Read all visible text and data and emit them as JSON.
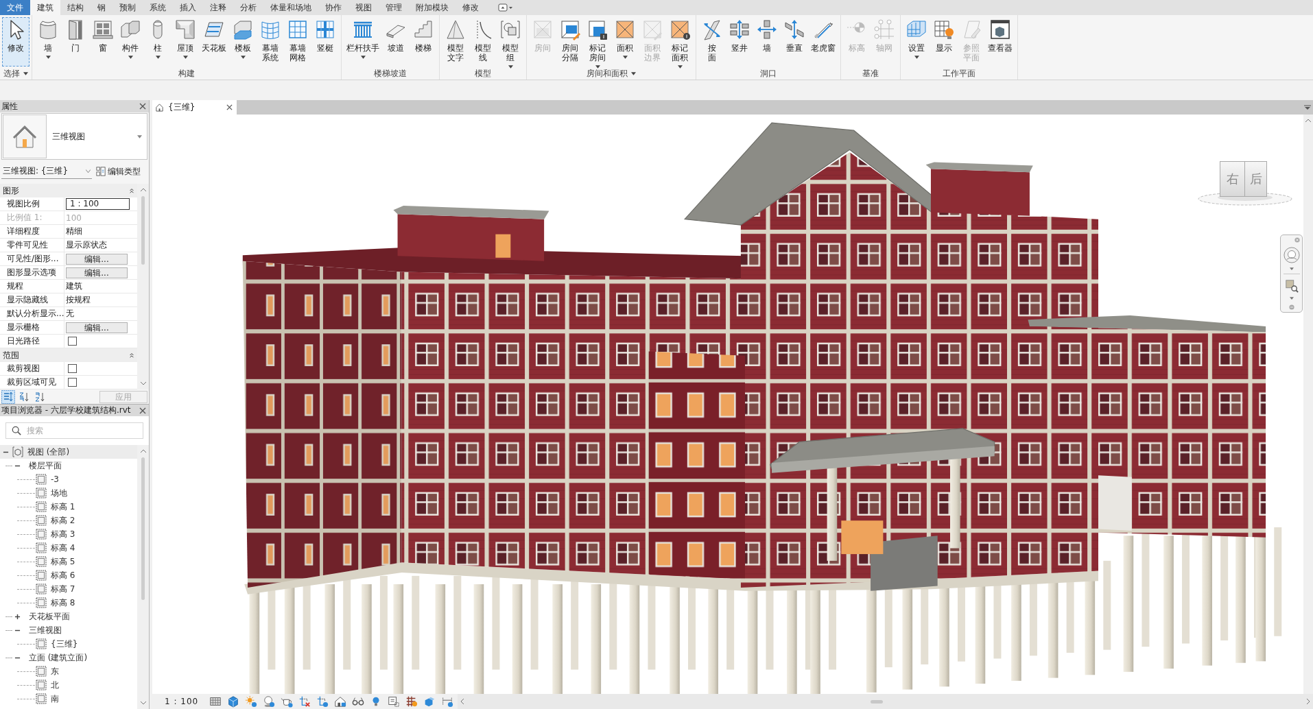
{
  "ribbon": {
    "tabs": [
      {
        "label": "文件",
        "kind": "file",
        "selected": false
      },
      {
        "label": "建筑",
        "kind": "tab",
        "selected": true
      },
      {
        "label": "结构",
        "kind": "tab",
        "selected": false
      },
      {
        "label": "钢",
        "kind": "tab",
        "selected": false
      },
      {
        "label": "预制",
        "kind": "tab",
        "selected": false
      },
      {
        "label": "系统",
        "kind": "tab",
        "selected": false
      },
      {
        "label": "插入",
        "kind": "tab",
        "selected": false
      },
      {
        "label": "注释",
        "kind": "tab",
        "selected": false
      },
      {
        "label": "分析",
        "kind": "tab",
        "selected": false
      },
      {
        "label": "体量和场地",
        "kind": "tab",
        "selected": false
      },
      {
        "label": "协作",
        "kind": "tab",
        "selected": false
      },
      {
        "label": "视图",
        "kind": "tab",
        "selected": false
      },
      {
        "label": "管理",
        "kind": "tab",
        "selected": false
      },
      {
        "label": "附加模块",
        "kind": "tab",
        "selected": false
      },
      {
        "label": "修改",
        "kind": "tab",
        "selected": false
      }
    ],
    "panels": [
      {
        "title": "选择",
        "menu": true,
        "tools": [
          {
            "label": "修改",
            "kind": "cursor",
            "selected": true,
            "disabled": false,
            "menu": false
          }
        ]
      },
      {
        "title": "构建",
        "menu": false,
        "tools": [
          {
            "label": "墙",
            "kind": "wall",
            "selected": false,
            "disabled": false,
            "menu": true
          },
          {
            "label": "门",
            "kind": "door",
            "selected": false,
            "disabled": false,
            "menu": false
          },
          {
            "label": "窗",
            "kind": "window",
            "selected": false,
            "disabled": false,
            "menu": false
          },
          {
            "label": "构件",
            "kind": "component",
            "selected": false,
            "disabled": false,
            "menu": true
          },
          {
            "label": "柱",
            "kind": "column",
            "selected": false,
            "disabled": false,
            "menu": true
          },
          {
            "label": "屋顶",
            "kind": "roof",
            "selected": false,
            "disabled": false,
            "menu": true
          },
          {
            "label": "天花板",
            "kind": "ceiling",
            "selected": false,
            "disabled": false,
            "menu": false
          },
          {
            "label": "楼板",
            "kind": "slab",
            "selected": false,
            "disabled": false,
            "menu": true
          },
          {
            "label": "幕墙系统",
            "kind": "curtainwall",
            "selected": false,
            "disabled": false,
            "menu": false
          },
          {
            "label": "幕墙网格",
            "kind": "curtaingrid",
            "selected": false,
            "disabled": false,
            "menu": false
          },
          {
            "label": "竖梃",
            "kind": "mullion",
            "selected": false,
            "disabled": false,
            "menu": false
          }
        ]
      },
      {
        "title": "楼梯坡道",
        "menu": false,
        "tools": [
          {
            "label": "栏杆扶手",
            "kind": "railing",
            "selected": false,
            "disabled": false,
            "menu": true
          },
          {
            "label": "坡道",
            "kind": "ramp",
            "selected": false,
            "disabled": false,
            "menu": false
          },
          {
            "label": "楼梯",
            "kind": "stair",
            "selected": false,
            "disabled": false,
            "menu": false
          }
        ]
      },
      {
        "title": "模型",
        "menu": false,
        "tools": [
          {
            "label": "模型文字",
            "kind": "modeltext",
            "selected": false,
            "disabled": false,
            "menu": false
          },
          {
            "label": "模型线",
            "kind": "modelline",
            "selected": false,
            "disabled": false,
            "menu": false
          },
          {
            "label": "模型组",
            "kind": "modelgroup",
            "selected": false,
            "disabled": false,
            "menu": true
          }
        ]
      },
      {
        "title": "房间和面积",
        "menu": true,
        "tools": [
          {
            "label": "房间",
            "kind": "room",
            "selected": false,
            "disabled": true,
            "menu": false
          },
          {
            "label": "房间分隔",
            "kind": "separator",
            "selected": false,
            "disabled": false,
            "menu": false
          },
          {
            "label": "标记房间",
            "kind": "roomtag",
            "selected": false,
            "disabled": false,
            "menu": true
          },
          {
            "label": "面积",
            "kind": "area",
            "selected": false,
            "disabled": false,
            "menu": true
          },
          {
            "label": "面积边界",
            "kind": "boundary",
            "selected": false,
            "disabled": true,
            "menu": false
          },
          {
            "label": "标记面积",
            "kind": "areatag",
            "selected": false,
            "disabled": false,
            "menu": true
          }
        ]
      },
      {
        "title": "洞口",
        "menu": false,
        "tools": [
          {
            "label": "按面",
            "kind": "byface",
            "selected": false,
            "disabled": false,
            "menu": false
          },
          {
            "label": "竖井",
            "kind": "shaft",
            "selected": false,
            "disabled": false,
            "menu": false
          },
          {
            "label": "墙",
            "kind": "wallopening",
            "selected": false,
            "disabled": false,
            "menu": false
          },
          {
            "label": "垂直",
            "kind": "vertical",
            "selected": false,
            "disabled": false,
            "menu": false
          },
          {
            "label": "老虎窗",
            "kind": "dormer",
            "selected": false,
            "disabled": false,
            "menu": false
          }
        ]
      },
      {
        "title": "基准",
        "menu": false,
        "tools": [
          {
            "label": "标高",
            "kind": "level",
            "selected": false,
            "disabled": true,
            "menu": false
          },
          {
            "label": "轴网",
            "kind": "grid",
            "selected": false,
            "disabled": true,
            "menu": false
          }
        ]
      },
      {
        "title": "工作平面",
        "menu": false,
        "tools": [
          {
            "label": "设置",
            "kind": "setplane",
            "selected": false,
            "disabled": false,
            "menu": true
          },
          {
            "label": "显示",
            "kind": "showplane",
            "selected": false,
            "disabled": false,
            "menu": false
          },
          {
            "label": "参照平面",
            "kind": "refplane",
            "selected": false,
            "disabled": true,
            "menu": false
          },
          {
            "label": "查看器",
            "kind": "viewer",
            "selected": false,
            "disabled": false,
            "menu": false
          }
        ]
      }
    ]
  },
  "properties": {
    "title": "属性",
    "type_selector": {
      "name": "三维视图"
    },
    "instance": {
      "label": "三维视图: {三维}",
      "edit_type": "编辑类型"
    },
    "groups": [
      {
        "title": "图形",
        "expanded": true,
        "rows": [
          {
            "label": "视图比例",
            "kind": "input",
            "value": "1 : 100",
            "disabled": false
          },
          {
            "label": "比例值 1:",
            "kind": "text",
            "value": "100",
            "disabled": true
          },
          {
            "label": "详细程度",
            "kind": "text",
            "value": "精细",
            "disabled": false
          },
          {
            "label": "零件可见性",
            "kind": "text",
            "value": "显示原状态",
            "disabled": false
          },
          {
            "label": "可见性/图形...",
            "kind": "button",
            "value": "编辑...",
            "disabled": false
          },
          {
            "label": "图形显示选项",
            "kind": "button",
            "value": "编辑...",
            "disabled": false
          },
          {
            "label": "规程",
            "kind": "text",
            "value": "建筑",
            "disabled": false
          },
          {
            "label": "显示隐藏线",
            "kind": "text",
            "value": "按规程",
            "disabled": false
          },
          {
            "label": "默认分析显示...",
            "kind": "text",
            "value": "无",
            "disabled": false
          },
          {
            "label": "显示栅格",
            "kind": "button",
            "value": "编辑...",
            "disabled": false
          },
          {
            "label": "日光路径",
            "kind": "checkbox",
            "checked": false,
            "disabled": false
          }
        ]
      },
      {
        "title": "范围",
        "expanded": true,
        "rows": [
          {
            "label": "裁剪视图",
            "kind": "checkbox",
            "checked": false,
            "disabled": false
          },
          {
            "label": "裁剪区域可见",
            "kind": "checkbox",
            "checked": false,
            "disabled": false
          }
        ]
      }
    ],
    "sort_buttons": [
      {
        "kind": "category",
        "selected": true
      },
      {
        "kind": "ascending",
        "selected": false
      },
      {
        "kind": "descending",
        "selected": false
      }
    ],
    "apply": {
      "label": "应用",
      "disabled": true
    }
  },
  "project_browser": {
    "title": "项目浏览器 - 六层学校建筑结构.rvt",
    "search": {
      "placeholder": "搜索"
    },
    "tree": [
      {
        "label": "视图 (全部)",
        "kind": "root",
        "selected": true,
        "expanded": true,
        "children": [
          {
            "label": "楼层平面",
            "kind": "group",
            "selected": false,
            "expanded": true,
            "children": [
              {
                "label": "-3",
                "kind": "view",
                "selected": false
              },
              {
                "label": "场地",
                "kind": "view",
                "selected": false
              },
              {
                "label": "标高 1",
                "kind": "view",
                "selected": false
              },
              {
                "label": "标高 2",
                "kind": "view",
                "selected": false
              },
              {
                "label": "标高 3",
                "kind": "view",
                "selected": false
              },
              {
                "label": "标高 4",
                "kind": "view",
                "selected": false
              },
              {
                "label": "标高 5",
                "kind": "view",
                "selected": false
              },
              {
                "label": "标高 6",
                "kind": "view",
                "selected": false
              },
              {
                "label": "标高 7",
                "kind": "view",
                "selected": false
              },
              {
                "label": "标高 8",
                "kind": "view",
                "selected": false
              }
            ]
          },
          {
            "label": "天花板平面",
            "kind": "group",
            "selected": false,
            "expanded": false
          },
          {
            "label": "三维视图",
            "kind": "group",
            "selected": false,
            "expanded": true,
            "children": [
              {
                "label": "{三维}",
                "kind": "view",
                "selected": false
              }
            ]
          },
          {
            "label": "立面 (建筑立面)",
            "kind": "group",
            "selected": false,
            "expanded": true,
            "children": [
              {
                "label": "东",
                "kind": "view",
                "selected": false
              },
              {
                "label": "北",
                "kind": "view",
                "selected": false
              },
              {
                "label": "南",
                "kind": "view",
                "selected": false
              }
            ]
          }
        ]
      }
    ]
  },
  "view": {
    "tab": {
      "title": "{三维}"
    },
    "view_cube": {
      "faces": [
        "右",
        "后"
      ]
    }
  },
  "status_bar": {
    "scale": "1 : 100"
  }
}
